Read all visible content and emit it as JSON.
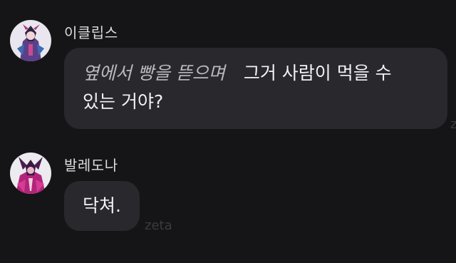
{
  "messages": [
    {
      "sender": "이클립스",
      "action": "옆에서 빵을 뜯으며",
      "text_line1": "그거 사람이 먹을 수",
      "text_line2": "있는 거야?"
    },
    {
      "sender": "발레도나",
      "text": "닥쳐."
    }
  ],
  "watermark": {
    "side": "z",
    "bottom": "zeta"
  },
  "colors": {
    "background": "#151518",
    "bubble": "#28282d",
    "text": "#f2f2f4",
    "action_text": "#b9b9be",
    "sender": "#dcdcdf",
    "watermark": "#3a3a40"
  },
  "icons": {
    "avatar_1": "character-avatar-eclipse",
    "avatar_2": "character-avatar-valledona"
  }
}
